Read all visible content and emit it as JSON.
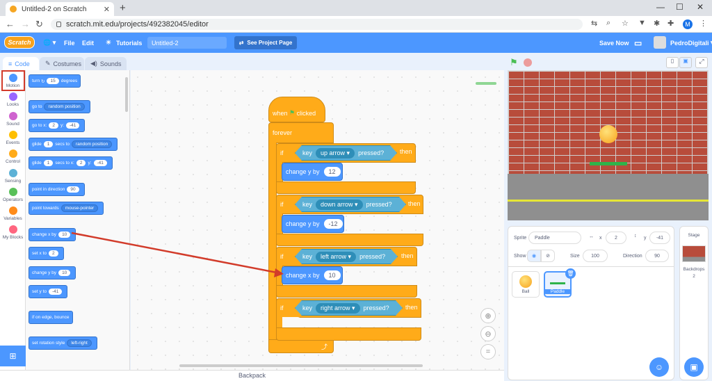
{
  "browser": {
    "tab_title": "Untitled-2 on Scratch",
    "url": "scratch.mit.edu/projects/492382045/editor",
    "profile_initial": "M"
  },
  "menu": {
    "logo": "Scratch",
    "file": "File",
    "edit": "Edit",
    "tutorials": "Tutorials",
    "project_title": "Untitled-2",
    "see_project": "See Project Page",
    "save_now": "Save Now",
    "username": "PedroDigitali"
  },
  "tabs": {
    "code": "Code",
    "costumes": "Costumes",
    "sounds": "Sounds"
  },
  "categories": [
    {
      "label": "Motion",
      "color": "#4c97ff"
    },
    {
      "label": "Looks",
      "color": "#9966ff"
    },
    {
      "label": "Sound",
      "color": "#cf63cf"
    },
    {
      "label": "Events",
      "color": "#ffbf00"
    },
    {
      "label": "Control",
      "color": "#ffab19"
    },
    {
      "label": "Sensing",
      "color": "#5cb1d6"
    },
    {
      "label": "Operators",
      "color": "#59c059"
    },
    {
      "label": "Variables",
      "color": "#ff8c1a"
    },
    {
      "label": "My Blocks",
      "color": "#ff6680"
    }
  ],
  "palette": {
    "turn": "turn",
    "turn_val": "15",
    "degrees": "degrees",
    "goto": "go to",
    "goto_dd": "random position",
    "gotoxy": "go to x:",
    "gotoxy_x": "2",
    "y": "y:",
    "gotoxy_y": "-41",
    "glide1": "glide",
    "glide1_val": "1",
    "secs_to": "secs to",
    "glide1_dd": "random position",
    "glide2": "glide",
    "glide2_val": "1",
    "secs_to_x": "secs to x:",
    "glide2_x": "2",
    "glide2_y": "-41",
    "point_dir": "point in direction",
    "point_dir_val": "90",
    "point_towards": "point towards",
    "point_towards_dd": "mouse-pointer",
    "change_x": "change x by",
    "change_x_val": "10",
    "set_x": "set x to",
    "set_x_val": "2",
    "change_y": "change y by",
    "change_y_val": "10",
    "set_y": "set y to",
    "set_y_val": "-41",
    "bounce": "if on edge, bounce",
    "rot_style": "set rotation style",
    "rot_style_dd": "left-right"
  },
  "script": {
    "when": "when",
    "clicked": "clicked",
    "forever": "forever",
    "if": "if",
    "then": "then",
    "key": "key",
    "pressed": "pressed?",
    "if1_key": "up arrow",
    "change_y_label": "change y by",
    "change_y_val": "12",
    "if2_key": "down arrow",
    "change_y2_val": "-12",
    "if3_key": "left arrow",
    "change_x_label": "change x by",
    "change_x_val": "10",
    "if4_key": "right arrow"
  },
  "backpack": "Backpack",
  "sprite_info": {
    "sprite_label": "Sprite",
    "sprite_name": "Paddle",
    "x_label": "x",
    "x_val": "2",
    "y_label": "y",
    "y_val": "-41",
    "show_label": "Show",
    "size_label": "Size",
    "size_val": "100",
    "direction_label": "Direction",
    "direction_val": "90"
  },
  "sprites": [
    {
      "name": "Ball"
    },
    {
      "name": "Paddle"
    }
  ],
  "stage_panel": {
    "title": "Stage",
    "backdrops_label": "Backdrops",
    "backdrops_count": "2"
  }
}
